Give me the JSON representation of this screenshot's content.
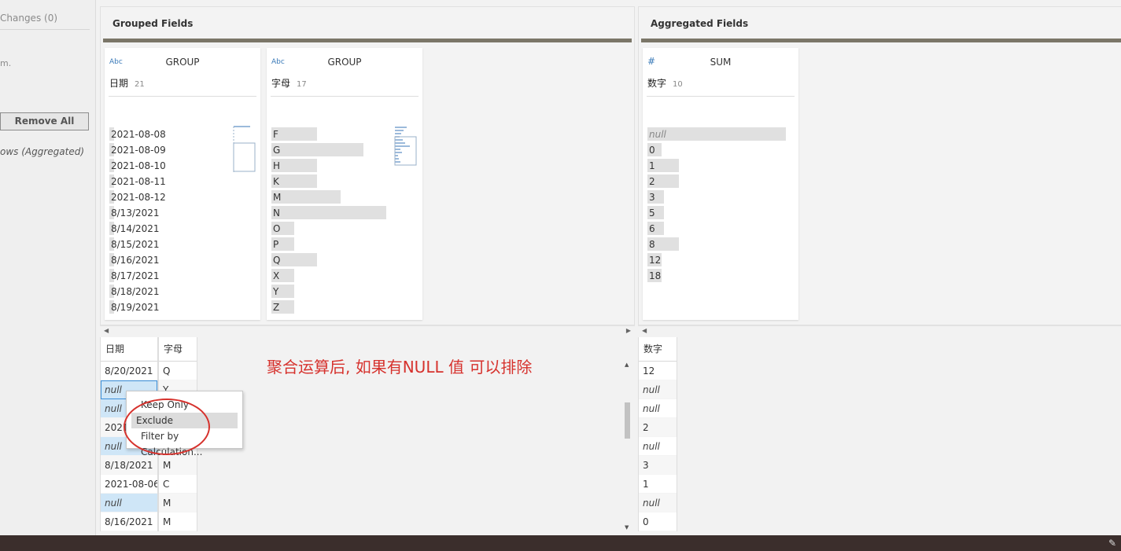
{
  "left_panel": {
    "changes_label": "Changes (0)",
    "fragment_text": "m.",
    "remove_all_label": "Remove All",
    "rows_label": "ows (Aggregated)"
  },
  "grouped": {
    "title": "Grouped Fields",
    "cards": [
      {
        "type_icon": "Abc",
        "aggregation": "GROUP",
        "field": "日期",
        "count": "21",
        "values": [
          "2021-08-08",
          "2021-08-09",
          "2021-08-10",
          "2021-08-11",
          "2021-08-12",
          "8/13/2021",
          "8/14/2021",
          "8/15/2021",
          "8/16/2021",
          "8/17/2021",
          "8/18/2021",
          "8/19/2021"
        ],
        "bar_fraction": [
          0.05,
          0.05,
          0.05,
          0.05,
          0.05,
          0.05,
          0.05,
          0.05,
          0.05,
          0.05,
          0.05,
          0.05
        ]
      },
      {
        "type_icon": "Abc",
        "aggregation": "GROUP",
        "field": "字母",
        "count": "17",
        "values": [
          "F",
          "G",
          "H",
          "K",
          "M",
          "N",
          "O",
          "P",
          "Q",
          "X",
          "Y",
          "Z"
        ],
        "bar_fraction": [
          0.4,
          0.8,
          0.4,
          0.4,
          0.6,
          1.0,
          0.2,
          0.2,
          0.4,
          0.2,
          0.2,
          0.2
        ]
      }
    ]
  },
  "aggregated": {
    "title": "Aggregated Fields",
    "cards": [
      {
        "type_icon": "#",
        "aggregation": "SUM",
        "field": "数字",
        "count": "10",
        "values": [
          "null",
          "0",
          "1",
          "2",
          "3",
          "5",
          "6",
          "8",
          "12",
          "18"
        ],
        "bar_fraction": [
          1.0,
          0.1,
          0.23,
          0.23,
          0.12,
          0.12,
          0.12,
          0.23,
          0.1,
          0.1
        ]
      }
    ]
  },
  "table": {
    "headers": [
      "日期",
      "字母"
    ],
    "rows": [
      [
        "8/20/2021",
        "Q"
      ],
      [
        "null",
        "Y"
      ],
      [
        "null",
        ""
      ],
      [
        "2021",
        ""
      ],
      [
        "null",
        "X"
      ],
      [
        "8/18/2021",
        "M"
      ],
      [
        "2021-08-06",
        "C"
      ],
      [
        "null",
        "M"
      ],
      [
        "8/16/2021",
        "M"
      ]
    ]
  },
  "agg_table": {
    "header": "数字",
    "rows": [
      "12",
      "null",
      "null",
      "2",
      "null",
      "3",
      "1",
      "null",
      "0"
    ]
  },
  "annotation": "聚合运算后, 如果有NULL 值 可以排除",
  "context_menu": {
    "items": [
      "Keep Only",
      "Exclude",
      "Filter by Calculation..."
    ]
  }
}
